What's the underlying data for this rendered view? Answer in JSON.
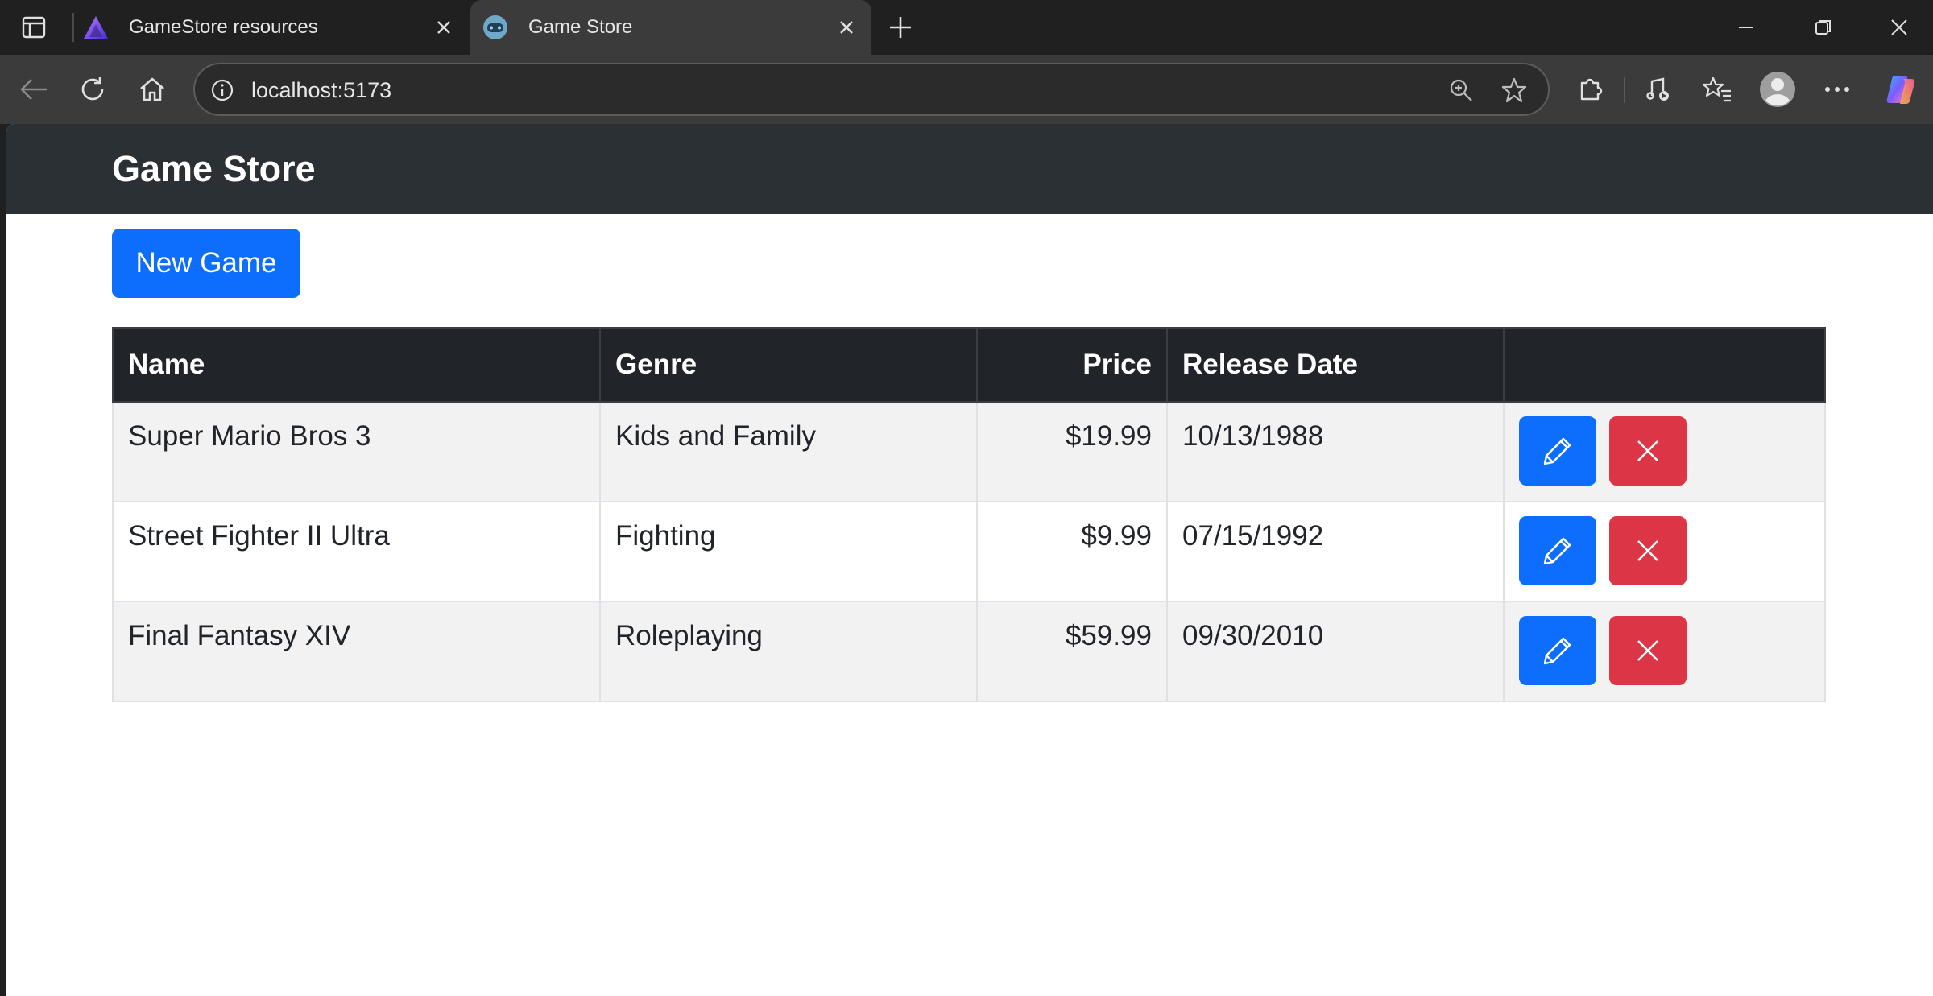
{
  "browser": {
    "tabs": [
      {
        "title": "GameStore resources",
        "favicon": "triangle-logo-icon",
        "active": false
      },
      {
        "title": "Game Store",
        "favicon": "game-controller-icon",
        "active": true
      }
    ],
    "address": "localhost:5173"
  },
  "app": {
    "brand": "Game Store",
    "new_button": "New Game",
    "table": {
      "headers": {
        "name": "Name",
        "genre": "Genre",
        "price": "Price",
        "release_date": "Release Date"
      },
      "rows": [
        {
          "name": "Super Mario Bros 3",
          "genre": "Kids and Family",
          "price": "$19.99",
          "release_date": "10/13/1988"
        },
        {
          "name": "Street Fighter II Ultra",
          "genre": "Fighting",
          "price": "$9.99",
          "release_date": "07/15/1992"
        },
        {
          "name": "Final Fantasy XIV",
          "genre": "Roleplaying",
          "price": "$59.99",
          "release_date": "09/30/2010"
        }
      ]
    }
  },
  "colors": {
    "primary": "#0d6efd",
    "danger": "#dc3545",
    "navbar": "#2b3035",
    "table_header": "#212529"
  }
}
